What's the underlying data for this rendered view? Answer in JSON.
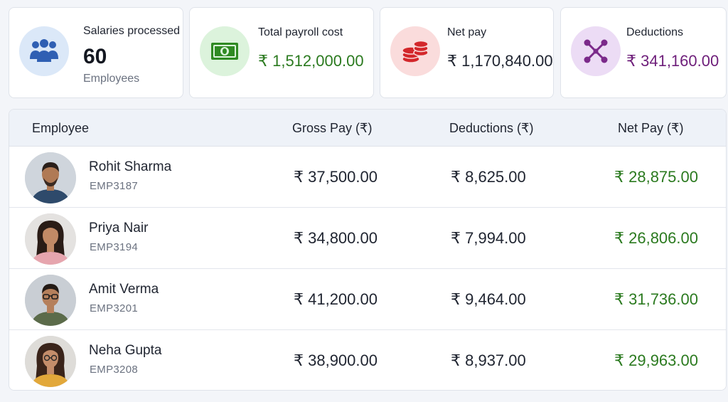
{
  "summary": {
    "salaries": {
      "label": "Salaries processed",
      "value": "60",
      "sub": "Employees",
      "icon": "people-group-icon",
      "color": "#2f5fb3"
    },
    "total": {
      "label": "Total payroll cost",
      "value": "₹ 1,512,000.00",
      "icon": "banknote-icon",
      "color": "#2b7a1f"
    },
    "net": {
      "label": "Net pay",
      "value": "₹ 1,170,840.00",
      "icon": "coin-stack-icon",
      "color": "#1f2430"
    },
    "deductions": {
      "label": "Deductions",
      "value": "₹ 341,160.00",
      "icon": "network-nodes-icon",
      "color": "#6e1e7a"
    }
  },
  "table": {
    "columns": [
      "Employee",
      "Gross Pay (₹)",
      "Deductions (₹)",
      "Net Pay (₹)"
    ],
    "rows": [
      {
        "name": "Rohit Sharma",
        "id": "EMP3187",
        "gross": "₹ 37,500.00",
        "deductions": "₹ 8,625.00",
        "net": "₹ 28,875.00"
      },
      {
        "name": "Priya Nair",
        "id": "EMP3194",
        "gross": "₹ 34,800.00",
        "deductions": "₹ 7,994.00",
        "net": "₹ 26,806.00"
      },
      {
        "name": "Amit Verma",
        "id": "EMP3201",
        "gross": "₹ 41,200.00",
        "deductions": "₹ 9,464.00",
        "net": "₹ 31,736.00"
      },
      {
        "name": "Neha Gupta",
        "id": "EMP3208",
        "gross": "₹ 38,900.00",
        "deductions": "₹ 8,937.00",
        "net": "₹ 29,963.00"
      }
    ]
  }
}
